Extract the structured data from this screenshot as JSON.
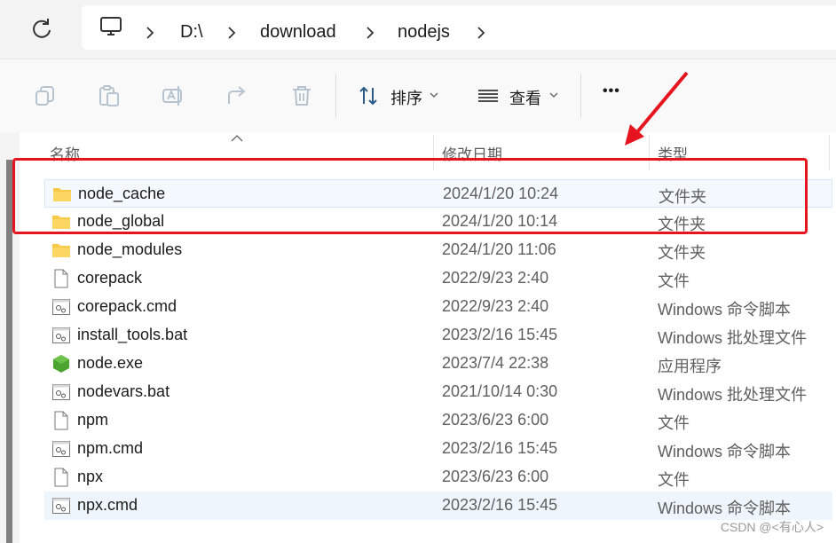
{
  "address": {
    "crumbs": [
      "D:\\",
      "download",
      "nodejs"
    ]
  },
  "toolbar": {
    "sort_label": "排序",
    "view_label": "查看",
    "more_label": "•••"
  },
  "columns": {
    "name": "名称",
    "date": "修改日期",
    "type": "类型"
  },
  "files": [
    {
      "name": "node_cache",
      "date": "2024/1/20 10:24",
      "type": "文件夹",
      "icon": "folder-icon"
    },
    {
      "name": "node_global",
      "date": "2024/1/20 10:14",
      "type": "文件夹",
      "icon": "folder-icon"
    },
    {
      "name": "node_modules",
      "date": "2024/1/20 11:06",
      "type": "文件夹",
      "icon": "folder-icon"
    },
    {
      "name": "corepack",
      "date": "2022/9/23 2:40",
      "type": "文件",
      "icon": "file-icon"
    },
    {
      "name": "corepack.cmd",
      "date": "2022/9/23 2:40",
      "type": "Windows 命令脚本",
      "icon": "script-icon"
    },
    {
      "name": "install_tools.bat",
      "date": "2023/2/16 15:45",
      "type": "Windows 批处理文件",
      "icon": "script-icon"
    },
    {
      "name": "node.exe",
      "date": "2023/7/4 22:38",
      "type": "应用程序",
      "icon": "node-exe-icon"
    },
    {
      "name": "nodevars.bat",
      "date": "2021/10/14 0:30",
      "type": "Windows 批处理文件",
      "icon": "script-icon"
    },
    {
      "name": "npm",
      "date": "2023/6/23 6:00",
      "type": "文件",
      "icon": "file-icon"
    },
    {
      "name": "npm.cmd",
      "date": "2023/2/16 15:45",
      "type": "Windows 命令脚本",
      "icon": "script-icon"
    },
    {
      "name": "npx",
      "date": "2023/6/23 6:00",
      "type": "文件",
      "icon": "file-icon"
    },
    {
      "name": "npx.cmd",
      "date": "2023/2/16 15:45",
      "type": "Windows 命令脚本",
      "icon": "script-icon"
    }
  ],
  "annotation": {
    "highlight_color": "#e5141e"
  },
  "watermark": "CSDN @<有心人>"
}
